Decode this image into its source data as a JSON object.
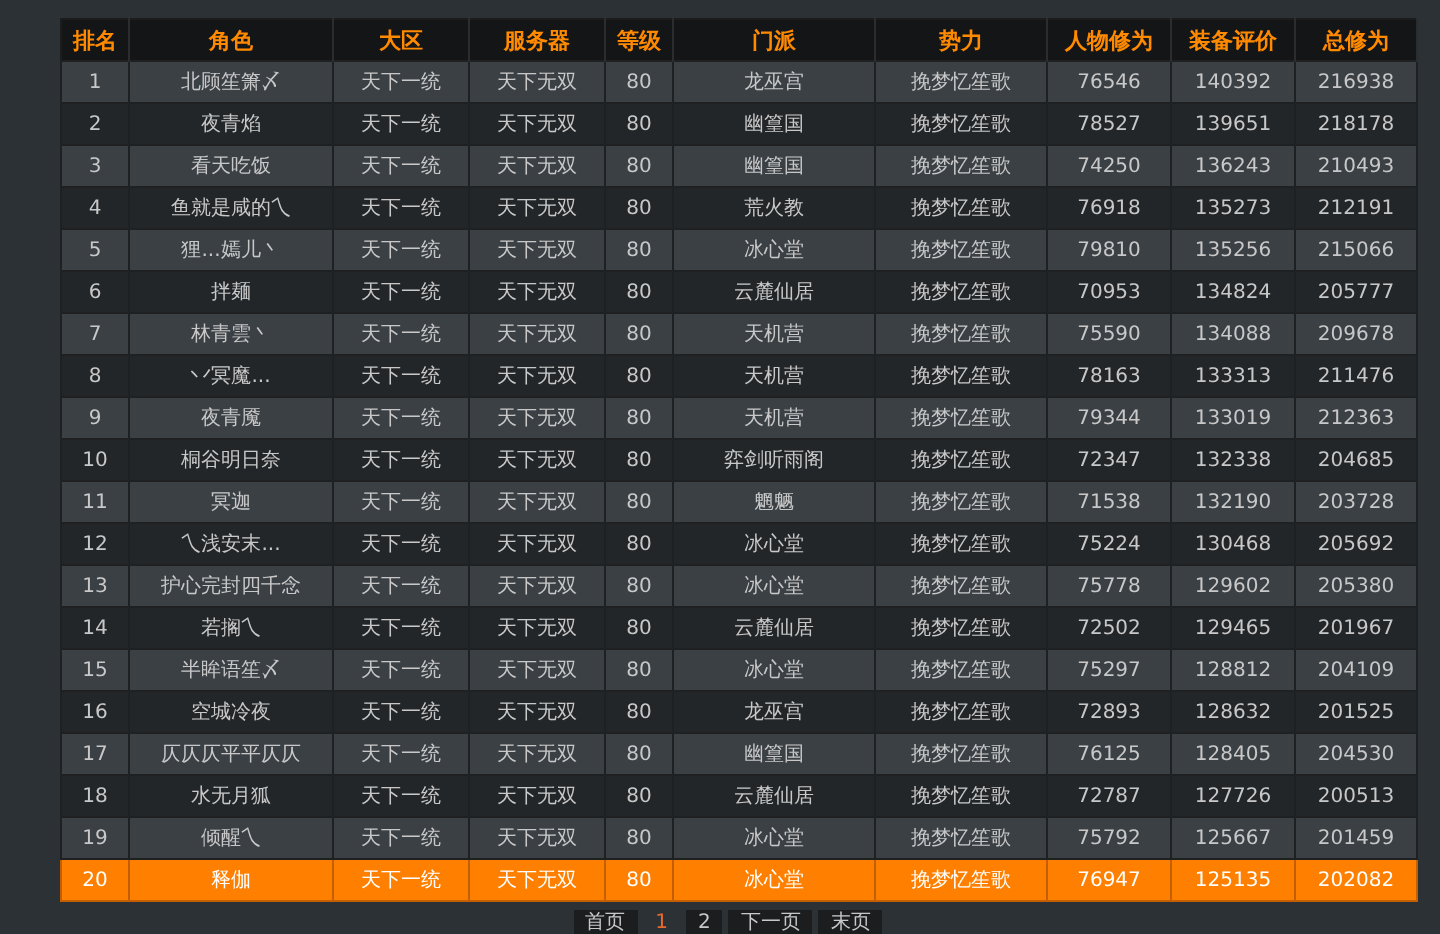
{
  "table": {
    "columns": [
      "排名",
      "角色",
      "大区",
      "服务器",
      "等级",
      "门派",
      "势力",
      "人物修为",
      "装备评价",
      "总修为"
    ],
    "rows": [
      {
        "cells": [
          "1",
          "北顾笙箫〆",
          "天下一统",
          "天下无双",
          "80",
          "龙巫宫",
          "挽梦忆笙歌",
          "76546",
          "140392",
          "216938"
        ],
        "selected": false
      },
      {
        "cells": [
          "2",
          "夜青焰",
          "天下一统",
          "天下无双",
          "80",
          "幽篁国",
          "挽梦忆笙歌",
          "78527",
          "139651",
          "218178"
        ],
        "selected": false
      },
      {
        "cells": [
          "3",
          "看天吃饭",
          "天下一统",
          "天下无双",
          "80",
          "幽篁国",
          "挽梦忆笙歌",
          "74250",
          "136243",
          "210493"
        ],
        "selected": false
      },
      {
        "cells": [
          "4",
          "鱼就是咸的乀",
          "天下一统",
          "天下无双",
          "80",
          "荒火教",
          "挽梦忆笙歌",
          "76918",
          "135273",
          "212191"
        ],
        "selected": false
      },
      {
        "cells": [
          "5",
          "狸...嫣儿丶",
          "天下一统",
          "天下无双",
          "80",
          "冰心堂",
          "挽梦忆笙歌",
          "79810",
          "135256",
          "215066"
        ],
        "selected": false
      },
      {
        "cells": [
          "6",
          "拌麺",
          "天下一统",
          "天下无双",
          "80",
          "云麓仙居",
          "挽梦忆笙歌",
          "70953",
          "134824",
          "205777"
        ],
        "selected": false
      },
      {
        "cells": [
          "7",
          "林青雲丶",
          "天下一统",
          "天下无双",
          "80",
          "天机营",
          "挽梦忆笙歌",
          "75590",
          "134088",
          "209678"
        ],
        "selected": false
      },
      {
        "cells": [
          "8",
          "丷冥魔...",
          "天下一统",
          "天下无双",
          "80",
          "天机营",
          "挽梦忆笙歌",
          "78163",
          "133313",
          "211476"
        ],
        "selected": false
      },
      {
        "cells": [
          "9",
          "夜青魇",
          "天下一统",
          "天下无双",
          "80",
          "天机营",
          "挽梦忆笙歌",
          "79344",
          "133019",
          "212363"
        ],
        "selected": false
      },
      {
        "cells": [
          "10",
          "桐谷明日奈",
          "天下一统",
          "天下无双",
          "80",
          "弈剑听雨阁",
          "挽梦忆笙歌",
          "72347",
          "132338",
          "204685"
        ],
        "selected": false
      },
      {
        "cells": [
          "11",
          "冥迦",
          "天下一统",
          "天下无双",
          "80",
          "魍魉",
          "挽梦忆笙歌",
          "71538",
          "132190",
          "203728"
        ],
        "selected": false
      },
      {
        "cells": [
          "12",
          "乀浅安末...",
          "天下一统",
          "天下无双",
          "80",
          "冰心堂",
          "挽梦忆笙歌",
          "75224",
          "130468",
          "205692"
        ],
        "selected": false
      },
      {
        "cells": [
          "13",
          "护心完封四千念",
          "天下一统",
          "天下无双",
          "80",
          "冰心堂",
          "挽梦忆笙歌",
          "75778",
          "129602",
          "205380"
        ],
        "selected": false
      },
      {
        "cells": [
          "14",
          "若搁乀",
          "天下一统",
          "天下无双",
          "80",
          "云麓仙居",
          "挽梦忆笙歌",
          "72502",
          "129465",
          "201967"
        ],
        "selected": false
      },
      {
        "cells": [
          "15",
          "半眸语笙〆",
          "天下一统",
          "天下无双",
          "80",
          "冰心堂",
          "挽梦忆笙歌",
          "75297",
          "128812",
          "204109"
        ],
        "selected": false
      },
      {
        "cells": [
          "16",
          "空城冷夜",
          "天下一统",
          "天下无双",
          "80",
          "龙巫宫",
          "挽梦忆笙歌",
          "72893",
          "128632",
          "201525"
        ],
        "selected": false
      },
      {
        "cells": [
          "17",
          "仄仄仄平平仄仄",
          "天下一统",
          "天下无双",
          "80",
          "幽篁国",
          "挽梦忆笙歌",
          "76125",
          "128405",
          "204530"
        ],
        "selected": false
      },
      {
        "cells": [
          "18",
          "水无月狐",
          "天下一统",
          "天下无双",
          "80",
          "云麓仙居",
          "挽梦忆笙歌",
          "72787",
          "127726",
          "200513"
        ],
        "selected": false
      },
      {
        "cells": [
          "19",
          "倾醒乀",
          "天下一统",
          "天下无双",
          "80",
          "冰心堂",
          "挽梦忆笙歌",
          "75792",
          "125667",
          "201459"
        ],
        "selected": false
      },
      {
        "cells": [
          "20",
          "释伽",
          "天下一统",
          "天下无双",
          "80",
          "冰心堂",
          "挽梦忆笙歌",
          "76947",
          "125135",
          "202082"
        ],
        "selected": true
      }
    ]
  },
  "pagination": [
    {
      "label": "首页",
      "selected": false
    },
    {
      "label": "1",
      "selected": true
    },
    {
      "label": "2",
      "selected": false
    },
    {
      "label": "下一页",
      "selected": false
    },
    {
      "label": "末页",
      "selected": false
    }
  ]
}
